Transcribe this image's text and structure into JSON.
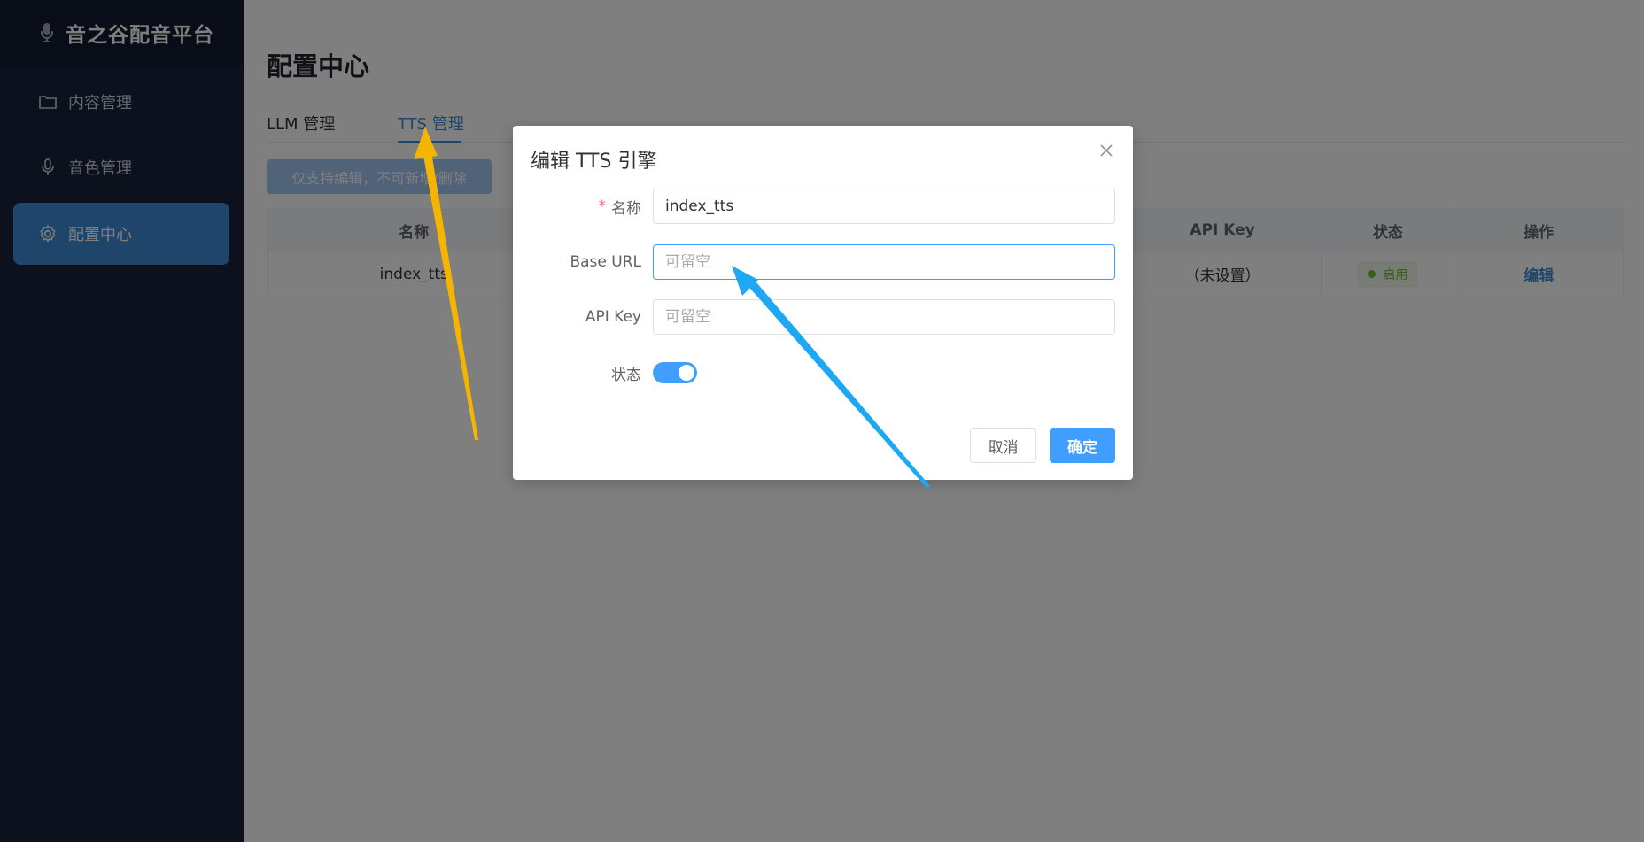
{
  "brand": {
    "title": "音之谷配音平台",
    "icon": "microphone-icon"
  },
  "sidebar": {
    "items": [
      {
        "label": "内容管理",
        "icon": "folder-icon",
        "active": false
      },
      {
        "label": "音色管理",
        "icon": "microphone-icon",
        "active": false
      },
      {
        "label": "配置中心",
        "icon": "gear-icon",
        "active": true
      }
    ]
  },
  "page": {
    "title": "配置中心"
  },
  "tabs": [
    {
      "label": "LLM 管理",
      "active": false
    },
    {
      "label": "TTS 管理",
      "active": true
    }
  ],
  "notice_button": {
    "label": "仅支持编辑，不可新增/删除"
  },
  "table": {
    "columns": [
      "名称",
      "",
      "API Key",
      "状态",
      "操作"
    ],
    "rows": [
      {
        "name": "index_tts",
        "base_url": "",
        "api_key": "（未设置）",
        "status": "启用",
        "action": "编辑"
      }
    ]
  },
  "dialog": {
    "title": "编辑 TTS 引擎",
    "fields": {
      "name": {
        "label": "名称",
        "required": true,
        "value": "index_tts"
      },
      "base_url": {
        "label": "Base URL",
        "value": "",
        "placeholder": "可留空"
      },
      "api_key": {
        "label": "API Key",
        "value": "",
        "placeholder": "可留空"
      },
      "status": {
        "label": "状态",
        "enabled": true
      }
    },
    "cancel_label": "取消",
    "confirm_label": "确定"
  },
  "colors": {
    "sidebar_bg": "#18233a",
    "accent": "#3f8cd4",
    "primary": "#409eff",
    "success": "#67c23a",
    "annotation_yellow": "#f5b400",
    "annotation_blue": "#1ea7f2"
  }
}
